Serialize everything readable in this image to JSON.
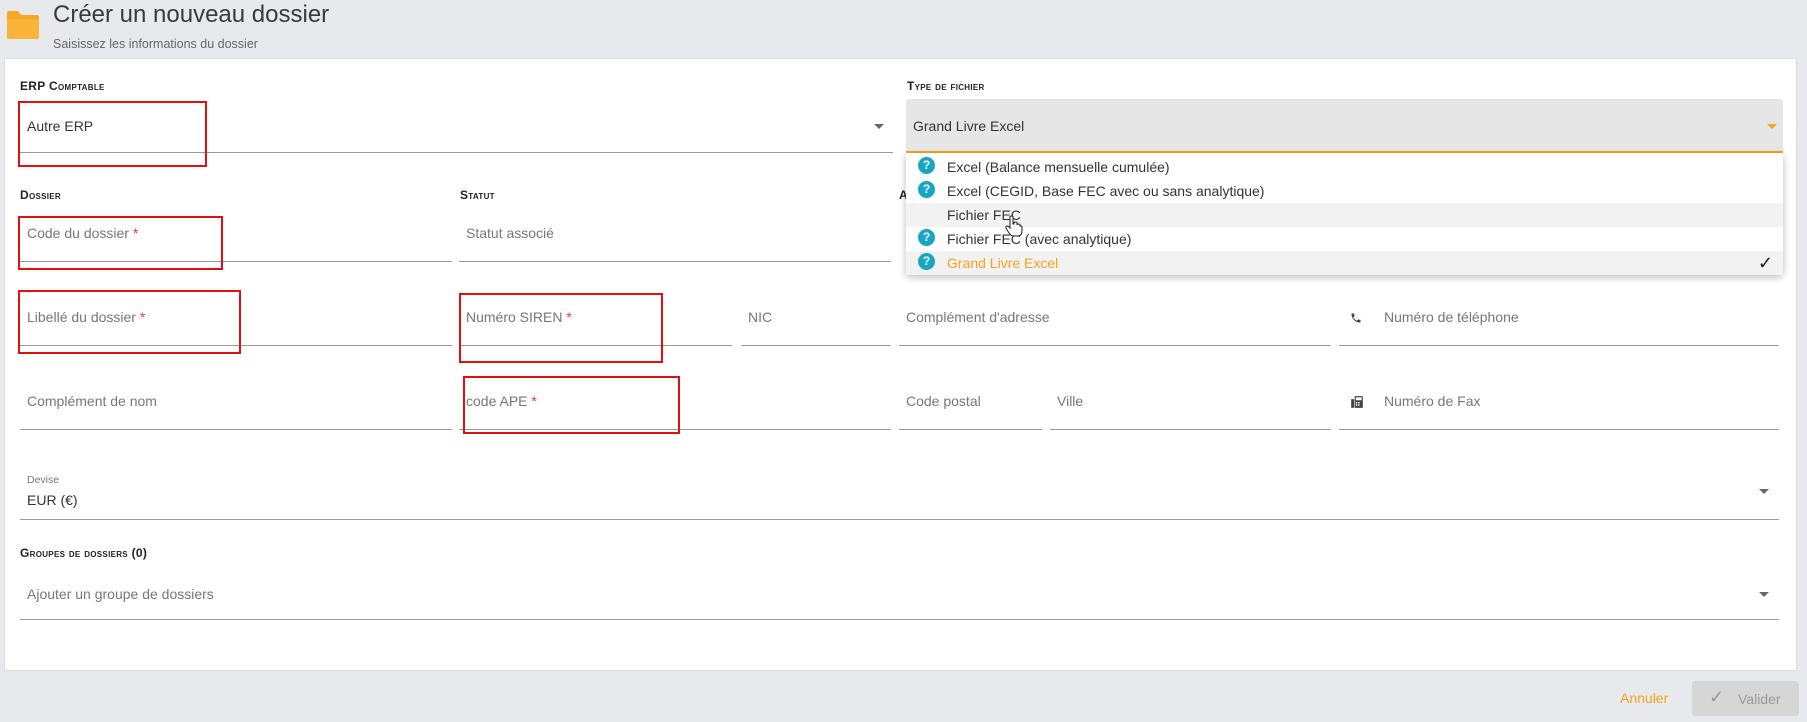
{
  "header": {
    "title": "Créer un nouveau dossier",
    "subtitle": "Saisissez les informations du dossier",
    "icon": "folder-icon"
  },
  "colors": {
    "accent": "#f7a21b",
    "required": "#e53935",
    "help": "#16a6c2",
    "annotation": "#e01010"
  },
  "erp": {
    "label": "ERP Comptable",
    "value": "Autre ERP"
  },
  "file_type": {
    "label": "Type de fichier",
    "value": "Grand Livre Excel",
    "options": [
      {
        "label": "Excel (Balance mensuelle cumulée)",
        "help": true
      },
      {
        "label": "Excel (CEGID, Base FEC avec ou sans analytique)",
        "help": true
      },
      {
        "label": "Fichier FEC",
        "help": false
      },
      {
        "label": "Fichier FEC (avec analytique)",
        "help": true
      },
      {
        "label": "Grand Livre Excel",
        "help": true,
        "selected": true
      }
    ]
  },
  "dossier": {
    "label": "Dossier",
    "code_placeholder": "Code du dossier",
    "libelle_placeholder": "Libellé du dossier",
    "complement_nom": "Complément de nom"
  },
  "statut": {
    "label": "Statut",
    "placeholder": "Statut associé",
    "siren": "Numéro SIREN",
    "nic": "NIC",
    "ape": "code APE"
  },
  "adresse": {
    "label_initial": "A",
    "complement": "Complément d'adresse",
    "code_postal": "Code postal",
    "ville": "Ville"
  },
  "contact": {
    "phone": "Numéro de téléphone",
    "fax": "Numéro de Fax"
  },
  "required_mark": "*",
  "devise": {
    "label": "Devise",
    "value": "EUR (€)"
  },
  "groupes": {
    "label": "Groupes de dossiers (0)",
    "placeholder": "Ajouter un groupe de dossiers"
  },
  "footer": {
    "cancel": "Annuler",
    "validate": "Valider"
  }
}
